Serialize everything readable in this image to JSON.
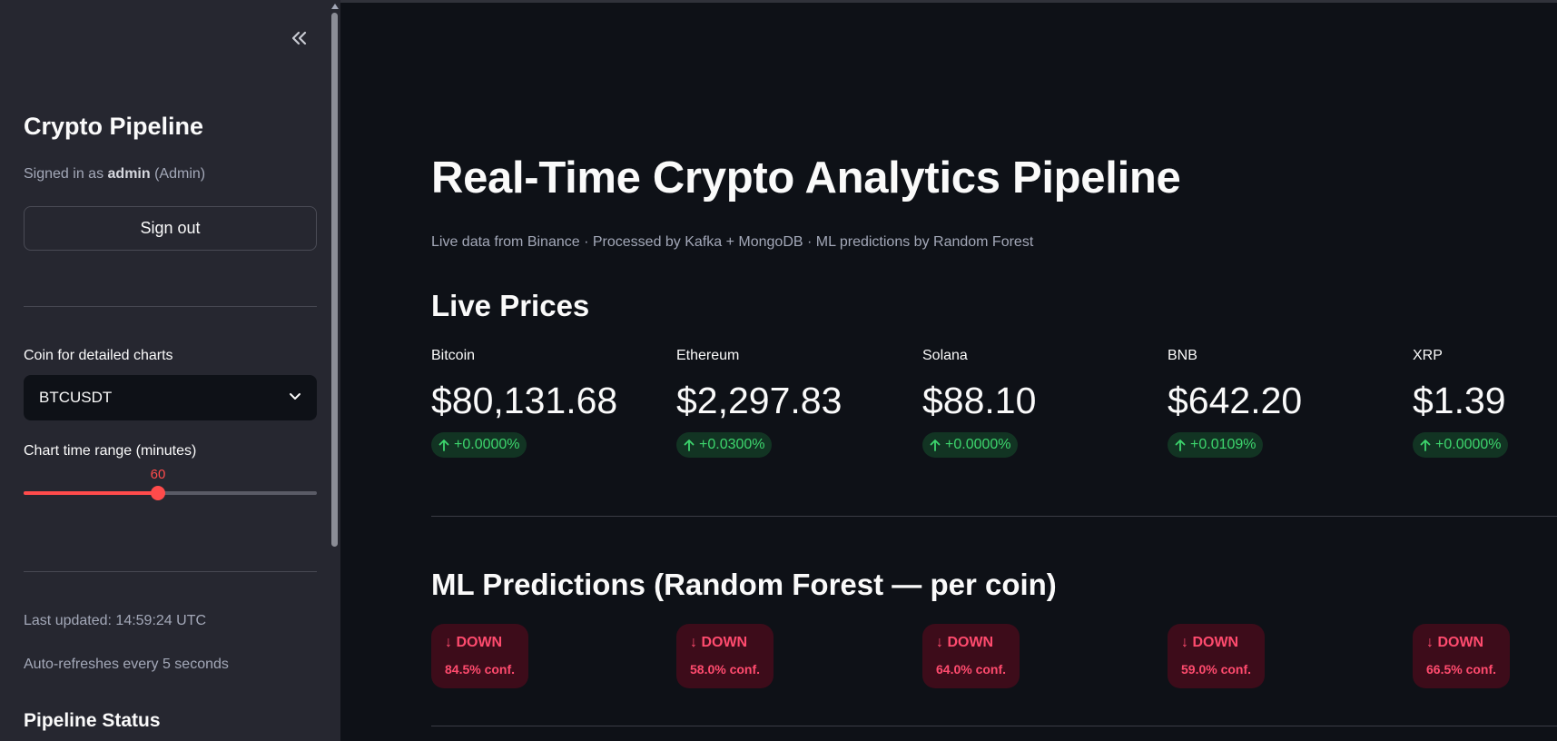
{
  "sidebar": {
    "title": "Crypto Pipeline",
    "signed_in_prefix": "Signed in as",
    "username": "admin",
    "role": "(Admin)",
    "sign_out_label": "Sign out",
    "coin_select_label": "Coin for detailed charts",
    "coin_selected": "BTCUSDT",
    "range_label": "Chart time range (minutes)",
    "range_value": "60",
    "range_fraction": 0.458,
    "last_updated": "Last updated: 14:59:24 UTC",
    "auto_refresh": "Auto-refreshes every 5 seconds",
    "pipeline_status_heading": "Pipeline Status",
    "collapse_icon": "double-chevron-left-icon"
  },
  "main": {
    "title": "Real-Time Crypto Analytics Pipeline",
    "caption": "Live data from Binance · Processed by Kafka + MongoDB · ML predictions by Random Forest",
    "live_prices_heading": "Live Prices",
    "prices": [
      {
        "label": "Bitcoin",
        "value": "$80,131.68",
        "delta": "+0.0000%"
      },
      {
        "label": "Ethereum",
        "value": "$2,297.83",
        "delta": "+0.0300%"
      },
      {
        "label": "Solana",
        "value": "$88.10",
        "delta": "+0.0000%"
      },
      {
        "label": "BNB",
        "value": "$642.20",
        "delta": "+0.0109%"
      },
      {
        "label": "XRP",
        "value": "$1.39",
        "delta": "+0.0000%"
      }
    ],
    "predictions_heading": "ML Predictions (Random Forest — per coin)",
    "predictions": [
      {
        "direction": "↓ DOWN",
        "confidence": "84.5% conf."
      },
      {
        "direction": "↓ DOWN",
        "confidence": "58.0% conf."
      },
      {
        "direction": "↓ DOWN",
        "confidence": "64.0% conf."
      },
      {
        "direction": "↓ DOWN",
        "confidence": "59.0% conf."
      },
      {
        "direction": "↓ DOWN",
        "confidence": "66.5% conf."
      }
    ]
  },
  "colors": {
    "accent": "#ff4b4b",
    "positive": "#3dd56d",
    "negative": "#ff4b6e",
    "sidebar_bg": "#262730",
    "main_bg": "#0e1117"
  }
}
